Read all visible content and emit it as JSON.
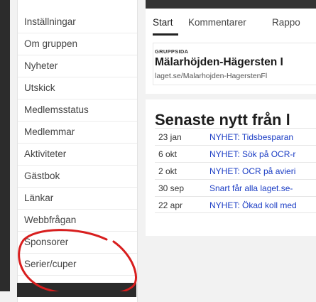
{
  "sidebar": {
    "items": [
      {
        "label": "Inställningar"
      },
      {
        "label": "Om gruppen"
      },
      {
        "label": "Nyheter"
      },
      {
        "label": "Utskick"
      },
      {
        "label": "Medlemsstatus"
      },
      {
        "label": "Medlemmar"
      },
      {
        "label": "Aktiviteter"
      },
      {
        "label": "Gästbok"
      },
      {
        "label": "Länkar"
      },
      {
        "label": "Webbfrågan"
      },
      {
        "label": "Sponsorer"
      },
      {
        "label": "Serier/cuper"
      }
    ]
  },
  "tabs": [
    {
      "label": "Start"
    },
    {
      "label": "Kommentarer"
    },
    {
      "label": "Rappo"
    }
  ],
  "group": {
    "label": "GRUPPSIDA",
    "name": "Mälarhöjden-Hägersten I",
    "url": "laget.se/Malarhojden-HagerstenFl"
  },
  "news": {
    "heading": "Senaste nytt från l",
    "rows": [
      {
        "date": "23 jan",
        "title": "NYHET: Tidsbesparan"
      },
      {
        "date": "6 okt",
        "title": "NYHET: Sök på OCR-r"
      },
      {
        "date": "2 okt",
        "title": "NYHET: OCR på avieri"
      },
      {
        "date": "30 sep",
        "title": "Snart får alla laget.se-"
      },
      {
        "date": "22 apr",
        "title": "NYHET: Ökad koll med"
      }
    ]
  },
  "annotation_color": "#d81e1e"
}
